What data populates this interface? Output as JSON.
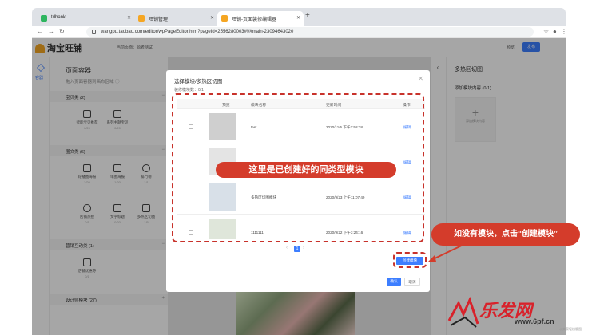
{
  "browser": {
    "tabs": [
      {
        "label": "tdbank",
        "color": "#2eb55f"
      },
      {
        "label": "旺铺管理",
        "color": "#f5a623"
      },
      {
        "label": "旺铺-页面装修编辑器",
        "color": "#f5a623"
      }
    ],
    "url": "wangpu.taobao.com/editor/wpPageEditor.htm?pageId=2556280003#!/#main-23094643020"
  },
  "app": {
    "logo": "淘宝旺铺",
    "current_page": "当前页面：源者测试",
    "preview": "预览",
    "publish": "发布"
  },
  "left_nav": {
    "label": "容器"
  },
  "left_panel": {
    "title": "页面容器",
    "hint": "拖入页面容器到画布区域 ⓘ",
    "sections": [
      {
        "title": "宝贝类  (2)",
        "modules": [
          {
            "name": "智能宝贝推荐",
            "count": "0/20"
          },
          {
            "name": "系列主题宝贝",
            "count": "0/20"
          }
        ]
      },
      {
        "title": "图文类  (6)",
        "modules": [
          {
            "name": "轮播图海报",
            "count": "2/20"
          },
          {
            "name": "单图海报",
            "count": "1/20"
          },
          {
            "name": "排行榜",
            "count": "1/1"
          },
          {
            "name": "店铺热搜",
            "count": "0/1"
          },
          {
            "name": "文字标题",
            "count": "0/20"
          },
          {
            "name": "多热区切图",
            "count": "1/5"
          }
        ]
      },
      {
        "title": "营销互动类  (1)",
        "modules": [
          {
            "name": "店铺优惠券",
            "count": "0/1"
          }
        ]
      },
      {
        "title": "设计师模块  (27)",
        "modules": []
      }
    ]
  },
  "right_panel": {
    "title": "多热区切图",
    "add_label": "添加模块内容  (0/1)",
    "box_label": "添加模块内容"
  },
  "modal": {
    "title": "选择模块/多热区切图",
    "count": "装修模块数：0/1",
    "columns": [
      "预览",
      "模块名称",
      "更新时间",
      "操作"
    ],
    "rows": [
      {
        "name": "test",
        "time": "2020/11/5 下午3:58:38",
        "action": "编辑",
        "thumb": "#cfcfcf"
      },
      {
        "name": "",
        "time": "",
        "action": "编辑",
        "thumb": "#e4e4e4"
      },
      {
        "name": "多热区切图模块",
        "time": "2020/9/23 上午11:07:49",
        "action": "编辑",
        "thumb": "#d8e0e8"
      },
      {
        "name": "1111111",
        "time": "2020/9/22 下午3:24:16",
        "action": "编辑",
        "thumb": "#dfe6da"
      }
    ],
    "page": "1",
    "create_button": "创建模块",
    "ok_button": "确认",
    "cancel_button": "取消"
  },
  "annotations": {
    "center": "这里是已创建好的同类型模块",
    "right": "如没有模块，点击“创建模块”",
    "color": "#d43c2b"
  },
  "watermark": {
    "logo": "乐发网",
    "url": "www.6pf.cn",
    "small": "@卖家轻松版图"
  }
}
